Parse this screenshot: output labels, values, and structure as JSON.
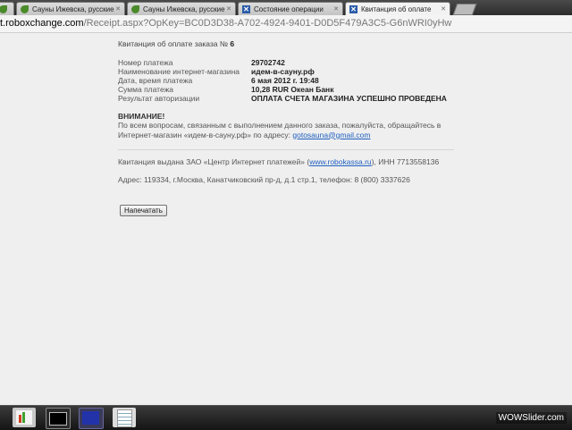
{
  "tabs": [
    {
      "label": "",
      "icon": "leaf-icon"
    },
    {
      "label": "Сауны Ижевска, русские,",
      "icon": "leaf-icon"
    },
    {
      "label": "Сауны Ижевска, русские,",
      "icon": "leaf-icon"
    },
    {
      "label": "Состояние операции",
      "icon": "robokassa-icon"
    },
    {
      "label": "Квитанция об оплате",
      "icon": "robokassa-icon"
    }
  ],
  "address": {
    "host": "t.roboxchange.com",
    "path": "/Receipt.aspx?OpKey=BC0D3D38-A702-4924-9401-D0D5F479A3C5-G6nWRI0yHw"
  },
  "receipt": {
    "title_prefix": "Квитанция об оплате заказа №",
    "order_number": "6",
    "rows": [
      {
        "label": "Номер платежа",
        "value": "29702742"
      },
      {
        "label": "Наименование интернет-магазина",
        "value": "идем-в-сауну.рф"
      },
      {
        "label": "Дата, время платежа",
        "value": "6 мая 2012 г. 19:48"
      },
      {
        "label": "Сумма платежа",
        "value": "10,28 RUR Океан Банк"
      },
      {
        "label": "Результат авторизации",
        "value": "ОПЛАТА СЧЕТА МАГАЗИНА УСПЕШНО ПРОВЕДЕНА"
      }
    ],
    "attention": "ВНИМАНИЕ!",
    "notice_text": "По всем вопросам, связанным с выполнением данного заказа, пожалуйста, обращайтесь в Интернет-магазин «идем-в-сауну.рф» по адресу:",
    "notice_email": "gotosauna@gmail.com",
    "issuer_text_1": "Квитанция выдана ЗАО «Центр Интернет платежей» (",
    "issuer_link": "www.robokassa.ru",
    "issuer_text_2": "), ИНН 7713558136",
    "issuer_address": "Адрес: 119334, г.Москва, Канатчиковский пр-д, д.1 стр.1, телефон: 8 (800) 3337626",
    "print_button": "Напечатать"
  },
  "taskbar": {
    "apps": [
      "chart-app-icon",
      "terminal-icon",
      "task-manager-icon",
      "notepad-icon"
    ]
  },
  "watermark": "WOWSlider.com",
  "colors": {
    "link": "#2060c0",
    "tab_active": "#f2f2f2",
    "taskbar": "#1e1e1e"
  }
}
